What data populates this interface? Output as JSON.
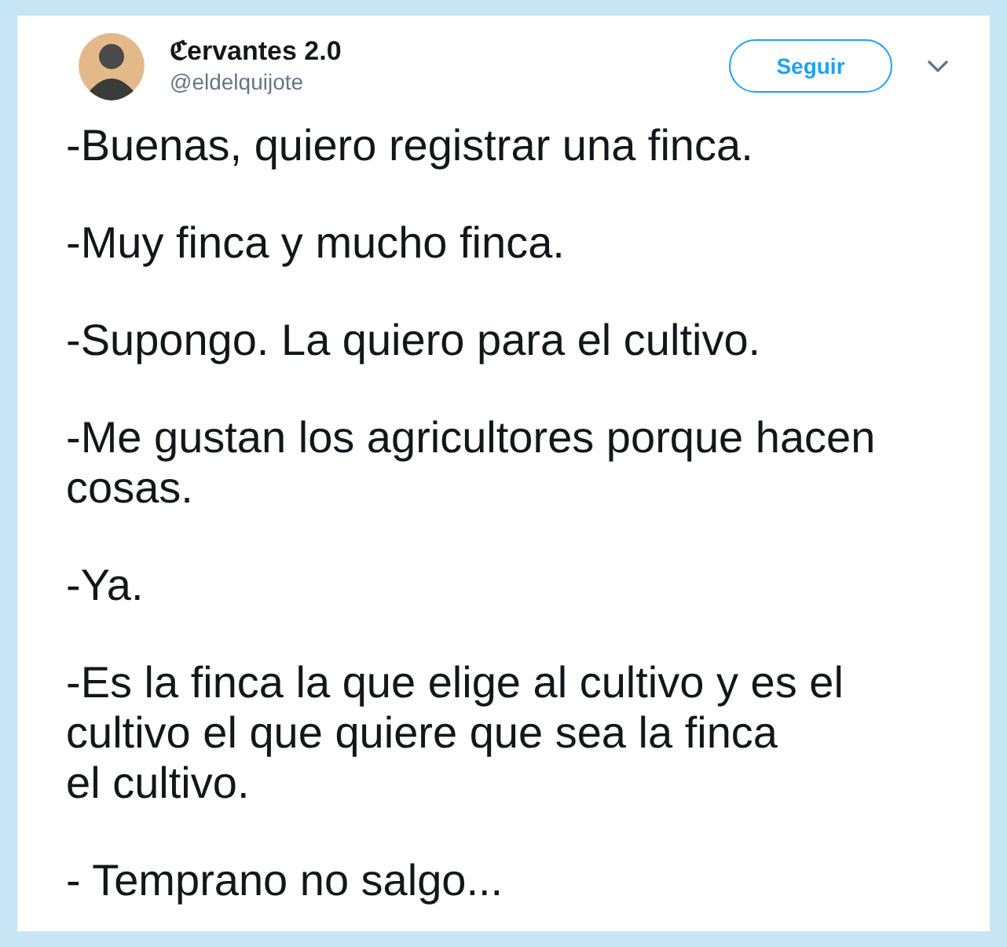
{
  "tweet": {
    "author": {
      "name": "ℭervantes 2.0",
      "handle": "@eldelquijote"
    },
    "follow_button": "Seguir",
    "paragraphs": [
      "-Buenas, quiero registrar una finca.",
      "-Muy finca y mucho finca.",
      "-Supongo. La quiero para el cultivo.",
      "-Me gustan los agricultores porque hacen cosas.",
      "-Ya.",
      "-Es la finca la que elige al cultivo y es el cultivo el que quiere que sea la finca\nel cultivo.",
      "- Temprano no salgo..."
    ]
  }
}
